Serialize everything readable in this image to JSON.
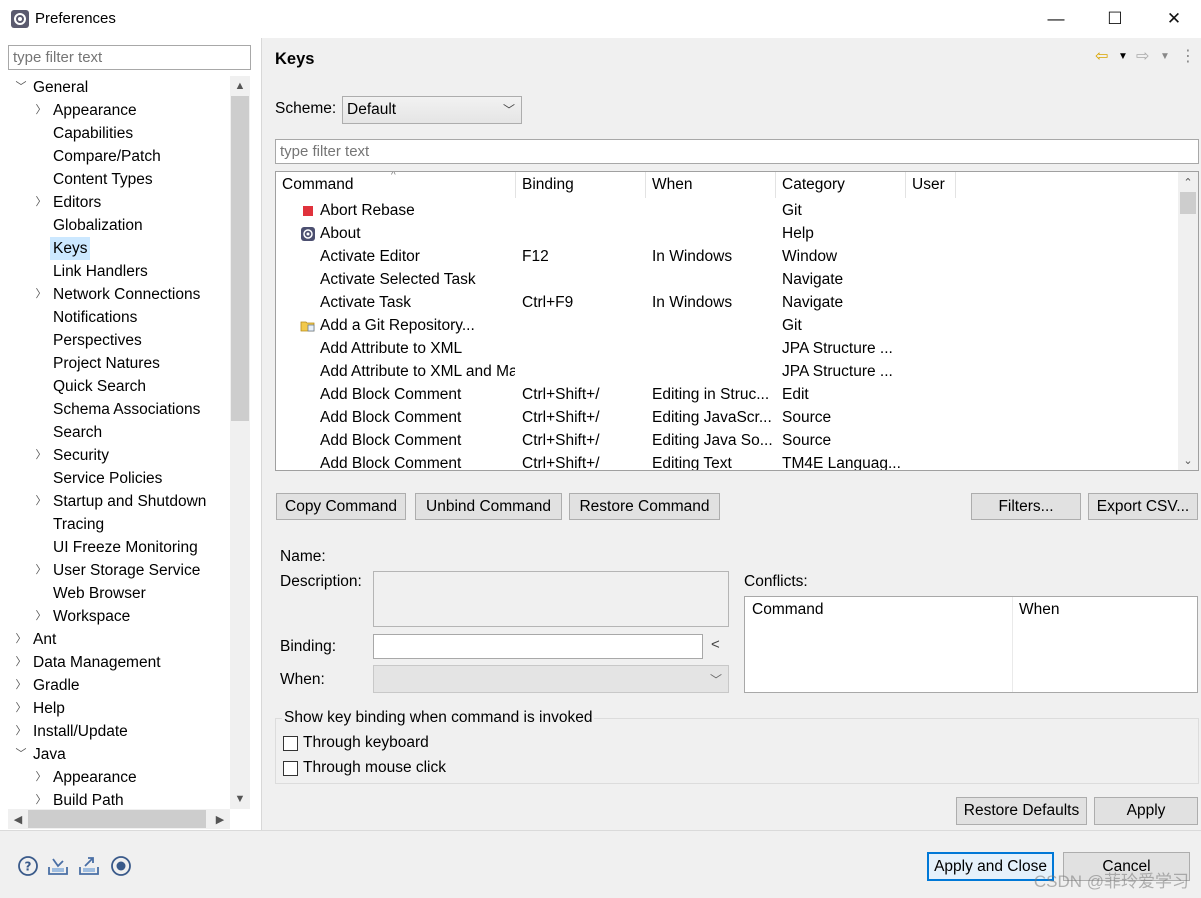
{
  "window": {
    "title": "Preferences",
    "controls": {
      "minimize": "—",
      "maximize": "☐",
      "close": "✕"
    }
  },
  "nav": {
    "filter_placeholder": "type filter text",
    "tree": [
      {
        "label": "General",
        "arrow": "expanded"
      },
      {
        "label": "Appearance",
        "arrow": "collapsed"
      },
      {
        "label": "Capabilities",
        "arrow": ""
      },
      {
        "label": "Compare/Patch",
        "arrow": ""
      },
      {
        "label": "Content Types",
        "arrow": ""
      },
      {
        "label": "Editors",
        "arrow": "collapsed"
      },
      {
        "label": "Globalization",
        "arrow": ""
      },
      {
        "label": "Keys",
        "arrow": "",
        "selected": true
      },
      {
        "label": "Link Handlers",
        "arrow": ""
      },
      {
        "label": "Network Connections",
        "arrow": "collapsed"
      },
      {
        "label": "Notifications",
        "arrow": ""
      },
      {
        "label": "Perspectives",
        "arrow": ""
      },
      {
        "label": "Project Natures",
        "arrow": ""
      },
      {
        "label": "Quick Search",
        "arrow": ""
      },
      {
        "label": "Schema Associations",
        "arrow": ""
      },
      {
        "label": "Search",
        "arrow": ""
      },
      {
        "label": "Security",
        "arrow": "collapsed"
      },
      {
        "label": "Service Policies",
        "arrow": ""
      },
      {
        "label": "Startup and Shutdown",
        "arrow": "collapsed"
      },
      {
        "label": "Tracing",
        "arrow": ""
      },
      {
        "label": "UI Freeze Monitoring",
        "arrow": ""
      },
      {
        "label": "User Storage Service",
        "arrow": "collapsed"
      },
      {
        "label": "Web Browser",
        "arrow": ""
      },
      {
        "label": "Workspace",
        "arrow": "collapsed"
      },
      {
        "label": "Ant",
        "arrow": "collapsed"
      },
      {
        "label": "Data Management",
        "arrow": "collapsed"
      },
      {
        "label": "Gradle",
        "arrow": "collapsed"
      },
      {
        "label": "Help",
        "arrow": "collapsed"
      },
      {
        "label": "Install/Update",
        "arrow": "collapsed"
      },
      {
        "label": "Java",
        "arrow": "expanded"
      },
      {
        "label": "Appearance",
        "arrow": "collapsed"
      },
      {
        "label": "Build Path",
        "arrow": "collapsed"
      }
    ]
  },
  "page": {
    "title": "Keys",
    "scheme_label": "Scheme:",
    "scheme_value": "Default",
    "filter_placeholder": "type filter text",
    "table": {
      "columns": [
        "Command",
        "Binding",
        "When",
        "Category",
        "User"
      ],
      "rows": [
        {
          "icon": "red-square-icon",
          "command": "Abort Rebase",
          "binding": "",
          "when": "",
          "category": "Git",
          "user": ""
        },
        {
          "icon": "eclipse-about-icon",
          "command": "About",
          "binding": "",
          "when": "",
          "category": "Help",
          "user": ""
        },
        {
          "icon": "",
          "command": "Activate Editor",
          "binding": "F12",
          "when": "In Windows",
          "category": "Window",
          "user": ""
        },
        {
          "icon": "",
          "command": "Activate Selected Task",
          "binding": "",
          "when": "",
          "category": "Navigate",
          "user": ""
        },
        {
          "icon": "",
          "command": "Activate Task",
          "binding": "Ctrl+F9",
          "when": "In Windows",
          "category": "Navigate",
          "user": ""
        },
        {
          "icon": "git-repo-add-icon",
          "command": "Add a Git Repository...",
          "binding": "",
          "when": "",
          "category": "Git",
          "user": ""
        },
        {
          "icon": "",
          "command": "Add Attribute to XML",
          "binding": "",
          "when": "",
          "category": "JPA Structure ...",
          "user": ""
        },
        {
          "icon": "",
          "command": "Add Attribute to XML and Map",
          "binding": "",
          "when": "",
          "category": "JPA Structure ...",
          "user": ""
        },
        {
          "icon": "",
          "command": "Add Block Comment",
          "binding": "Ctrl+Shift+/",
          "when": "Editing in Struc...",
          "category": "Edit",
          "user": ""
        },
        {
          "icon": "",
          "command": "Add Block Comment",
          "binding": "Ctrl+Shift+/",
          "when": "Editing JavaScr...",
          "category": "Source",
          "user": ""
        },
        {
          "icon": "",
          "command": "Add Block Comment",
          "binding": "Ctrl+Shift+/",
          "when": "Editing Java So...",
          "category": "Source",
          "user": ""
        },
        {
          "icon": "",
          "command": "Add Block Comment",
          "binding": "Ctrl+Shift+/",
          "when": "Editing Text",
          "category": "TM4E Languag...",
          "user": ""
        }
      ]
    },
    "buttons": {
      "copy": "Copy Command",
      "unbind": "Unbind Command",
      "restore": "Restore Command",
      "filters": "Filters...",
      "export": "Export CSV..."
    },
    "details": {
      "name_label": "Name:",
      "description_label": "Description:",
      "binding_label": "Binding:",
      "when_label": "When:",
      "binding_arrow": "<",
      "conflicts_label": "Conflicts:",
      "conflicts_columns": [
        "Command",
        "When"
      ]
    },
    "show_binding": {
      "title": "Show key binding when command is invoked",
      "through_keyboard": "Through keyboard",
      "through_mouse": "Through mouse click"
    },
    "restore_defaults": "Restore Defaults",
    "apply": "Apply"
  },
  "footer": {
    "apply_close": "Apply and Close",
    "cancel": "Cancel",
    "watermark": "CSDN @菲玲爱学习"
  },
  "colors": {
    "selection": "#cce8ff",
    "button_bg": "#e1e1e1",
    "focus_border": "#0078d7",
    "panel_bg": "#f0f0f0"
  }
}
